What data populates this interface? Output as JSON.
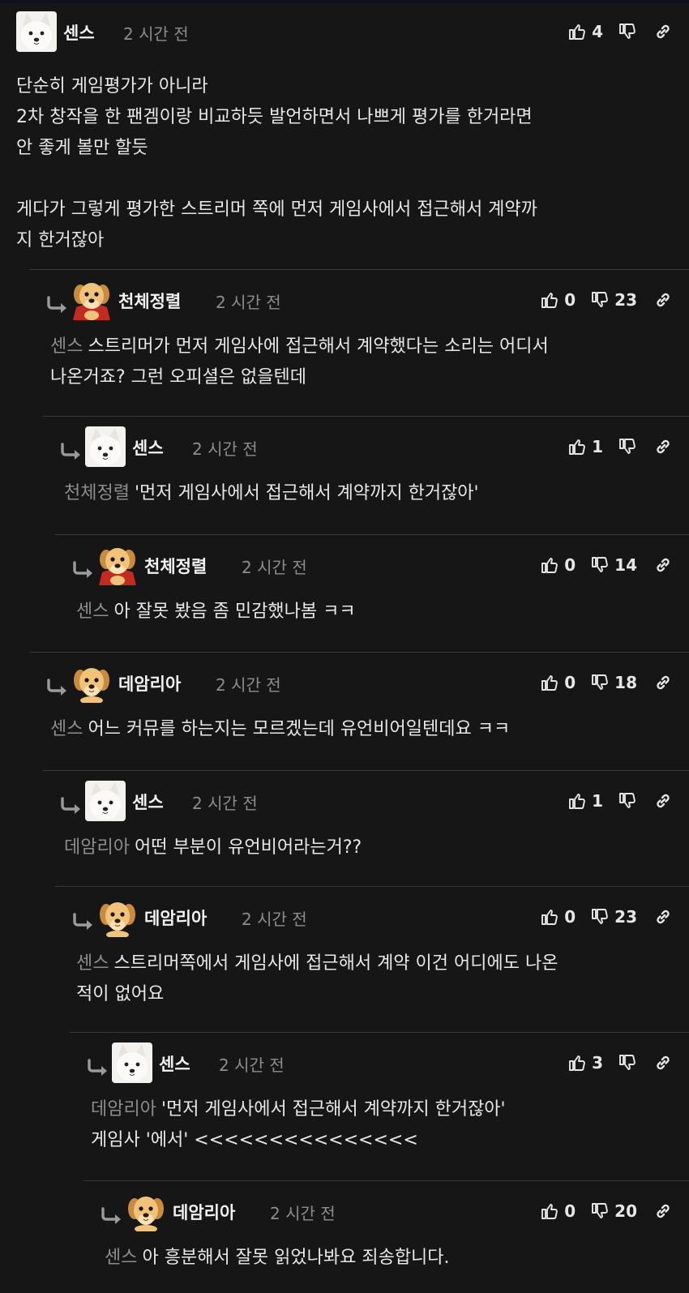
{
  "comments": [
    {
      "author": "센스",
      "time": "2 시간 전",
      "likes": "4",
      "dislikes": "",
      "avatar": "white-dog",
      "mention": "",
      "text": "단순히 게임평가가 아니라\n2차 창작을 한 팬겜이랑 비교하듯 발언하면서 나쁘게 평가를 한거라면\n안 좋게 볼만 할듯\n\n게다가 그렇게 평가한 스트리머 쪽에 먼저 게임사에서 접근해서 계약까\n지 한거잖아"
    },
    {
      "author": "천체정렬",
      "time": "2 시간 전",
      "likes": "0",
      "dislikes": "23",
      "avatar": "puppy-cape",
      "mention": "센스",
      "text": "스트리머가 먼저 게임사에 접근해서 계약했다는 소리는 어디서\n나온거죠? 그런 오피셜은 없을텐데"
    },
    {
      "author": "센스",
      "time": "2 시간 전",
      "likes": "1",
      "dislikes": "",
      "avatar": "white-dog",
      "mention": "천체정렬",
      "text": "'먼저 게임사에서 접근해서 계약까지 한거잖아'"
    },
    {
      "author": "천체정렬",
      "time": "2 시간 전",
      "likes": "0",
      "dislikes": "14",
      "avatar": "puppy-cape",
      "mention": "센스",
      "text": "아 잘못 봤음 좀 민감했나봄 ㅋㅋ"
    },
    {
      "author": "데암리아",
      "time": "2 시간 전",
      "likes": "0",
      "dislikes": "18",
      "avatar": "puppy",
      "mention": "센스",
      "text": "어느 커뮤를 하는지는 모르겠는데 유언비어일텐데요 ㅋㅋ"
    },
    {
      "author": "센스",
      "time": "2 시간 전",
      "likes": "1",
      "dislikes": "",
      "avatar": "white-dog",
      "mention": "데암리아",
      "text": "어떤 부분이 유언비어라는거??"
    },
    {
      "author": "데암리아",
      "time": "2 시간 전",
      "likes": "0",
      "dislikes": "23",
      "avatar": "puppy",
      "mention": "센스",
      "text": "스트리머쪽에서 게임사에 접근해서 계약 이건 어디에도 나온\n적이 없어요"
    },
    {
      "author": "센스",
      "time": "2 시간 전",
      "likes": "3",
      "dislikes": "",
      "avatar": "white-dog",
      "mention": "데암리아",
      "text": "'먼저 게임사에서 접근해서 계약까지 한거잖아'\n게임사 '에서' <<<<<<<<<<<<<<<"
    },
    {
      "author": "데암리아",
      "time": "2 시간 전",
      "likes": "0",
      "dislikes": "20",
      "avatar": "puppy",
      "mention": "센스",
      "text": "아 흥분해서 잘못 읽었나봐요 죄송합니다."
    }
  ]
}
